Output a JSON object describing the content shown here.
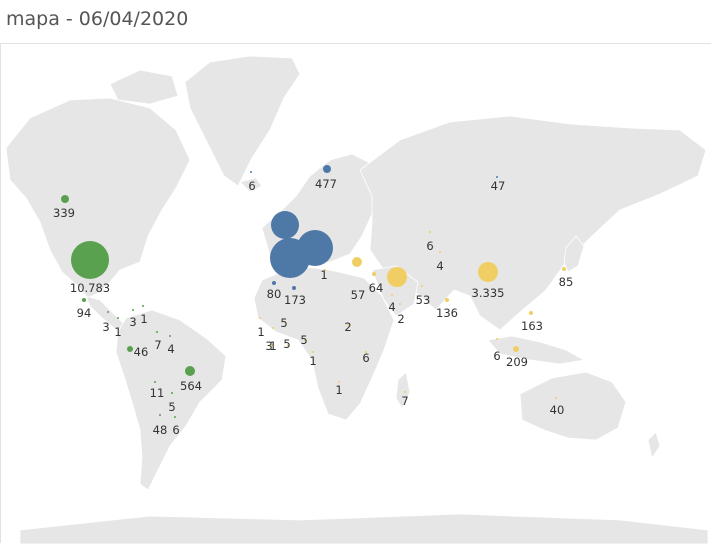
{
  "title": "mapa - 06/04/2020",
  "colors": {
    "americas": "#59a14f",
    "europe": "#4e79a7",
    "asia_africa_oceania": "#f1ce63",
    "land": "#e6e6e6",
    "background": "#ffffff"
  },
  "chart_data": {
    "type": "bubble-map",
    "title": "mapa - 06/04/2020",
    "points": [
      {
        "label": "10.783",
        "color": "americas"
      },
      {
        "label": "339",
        "color": "americas"
      },
      {
        "label": "94",
        "color": "americas"
      },
      {
        "label": "3",
        "color": "americas"
      },
      {
        "label": "1",
        "color": "americas"
      },
      {
        "label": "3",
        "color": "americas"
      },
      {
        "label": "1",
        "color": "americas"
      },
      {
        "label": "46",
        "color": "americas"
      },
      {
        "label": "7",
        "color": "americas"
      },
      {
        "label": "4",
        "color": "americas"
      },
      {
        "label": "564",
        "color": "americas"
      },
      {
        "label": "11",
        "color": "americas"
      },
      {
        "label": "5",
        "color": "americas"
      },
      {
        "label": "48",
        "color": "americas"
      },
      {
        "label": "6",
        "color": "americas"
      },
      {
        "label": "6",
        "color": "europe"
      },
      {
        "label": "477",
        "color": "europe"
      },
      {
        "label": "",
        "color": "europe"
      },
      {
        "label": "",
        "color": "europe"
      },
      {
        "label": "",
        "color": "europe"
      },
      {
        "label": "80",
        "color": "europe"
      },
      {
        "label": "173",
        "color": "europe"
      },
      {
        "label": "57",
        "color": "asia_africa_oceania"
      },
      {
        "label": "64",
        "color": "asia_africa_oceania"
      },
      {
        "label": "",
        "color": "asia_africa_oceania"
      },
      {
        "label": "4",
        "color": "asia_africa_oceania"
      },
      {
        "label": "2",
        "color": "asia_africa_oceania"
      },
      {
        "label": "53",
        "color": "asia_africa_oceania"
      },
      {
        "label": "6",
        "color": "asia_africa_oceania"
      },
      {
        "label": "4",
        "color": "asia_africa_oceania"
      },
      {
        "label": "136",
        "color": "asia_africa_oceania"
      },
      {
        "label": "3.335",
        "color": "asia_africa_oceania"
      },
      {
        "label": "85",
        "color": "asia_africa_oceania"
      },
      {
        "label": "163",
        "color": "asia_africa_oceania"
      },
      {
        "label": "6",
        "color": "asia_africa_oceania"
      },
      {
        "label": "209",
        "color": "asia_africa_oceania"
      },
      {
        "label": "47",
        "color": "europe"
      },
      {
        "label": "40",
        "color": "asia_africa_oceania"
      },
      {
        "label": "1",
        "color": "asia_africa_oceania"
      },
      {
        "label": "1",
        "color": "asia_africa_oceania"
      },
      {
        "label": "5",
        "color": "asia_africa_oceania"
      },
      {
        "label": "3",
        "color": "asia_africa_oceania"
      },
      {
        "label": "5",
        "color": "asia_africa_oceania"
      },
      {
        "label": "5",
        "color": "asia_africa_oceania"
      },
      {
        "label": "1",
        "color": "asia_africa_oceania"
      },
      {
        "label": "2",
        "color": "asia_africa_oceania"
      },
      {
        "label": "6",
        "color": "asia_africa_oceania"
      },
      {
        "label": "1",
        "color": "asia_africa_oceania"
      },
      {
        "label": "1",
        "color": "asia_africa_oceania"
      },
      {
        "label": "7",
        "color": "asia_africa_oceania"
      }
    ]
  }
}
